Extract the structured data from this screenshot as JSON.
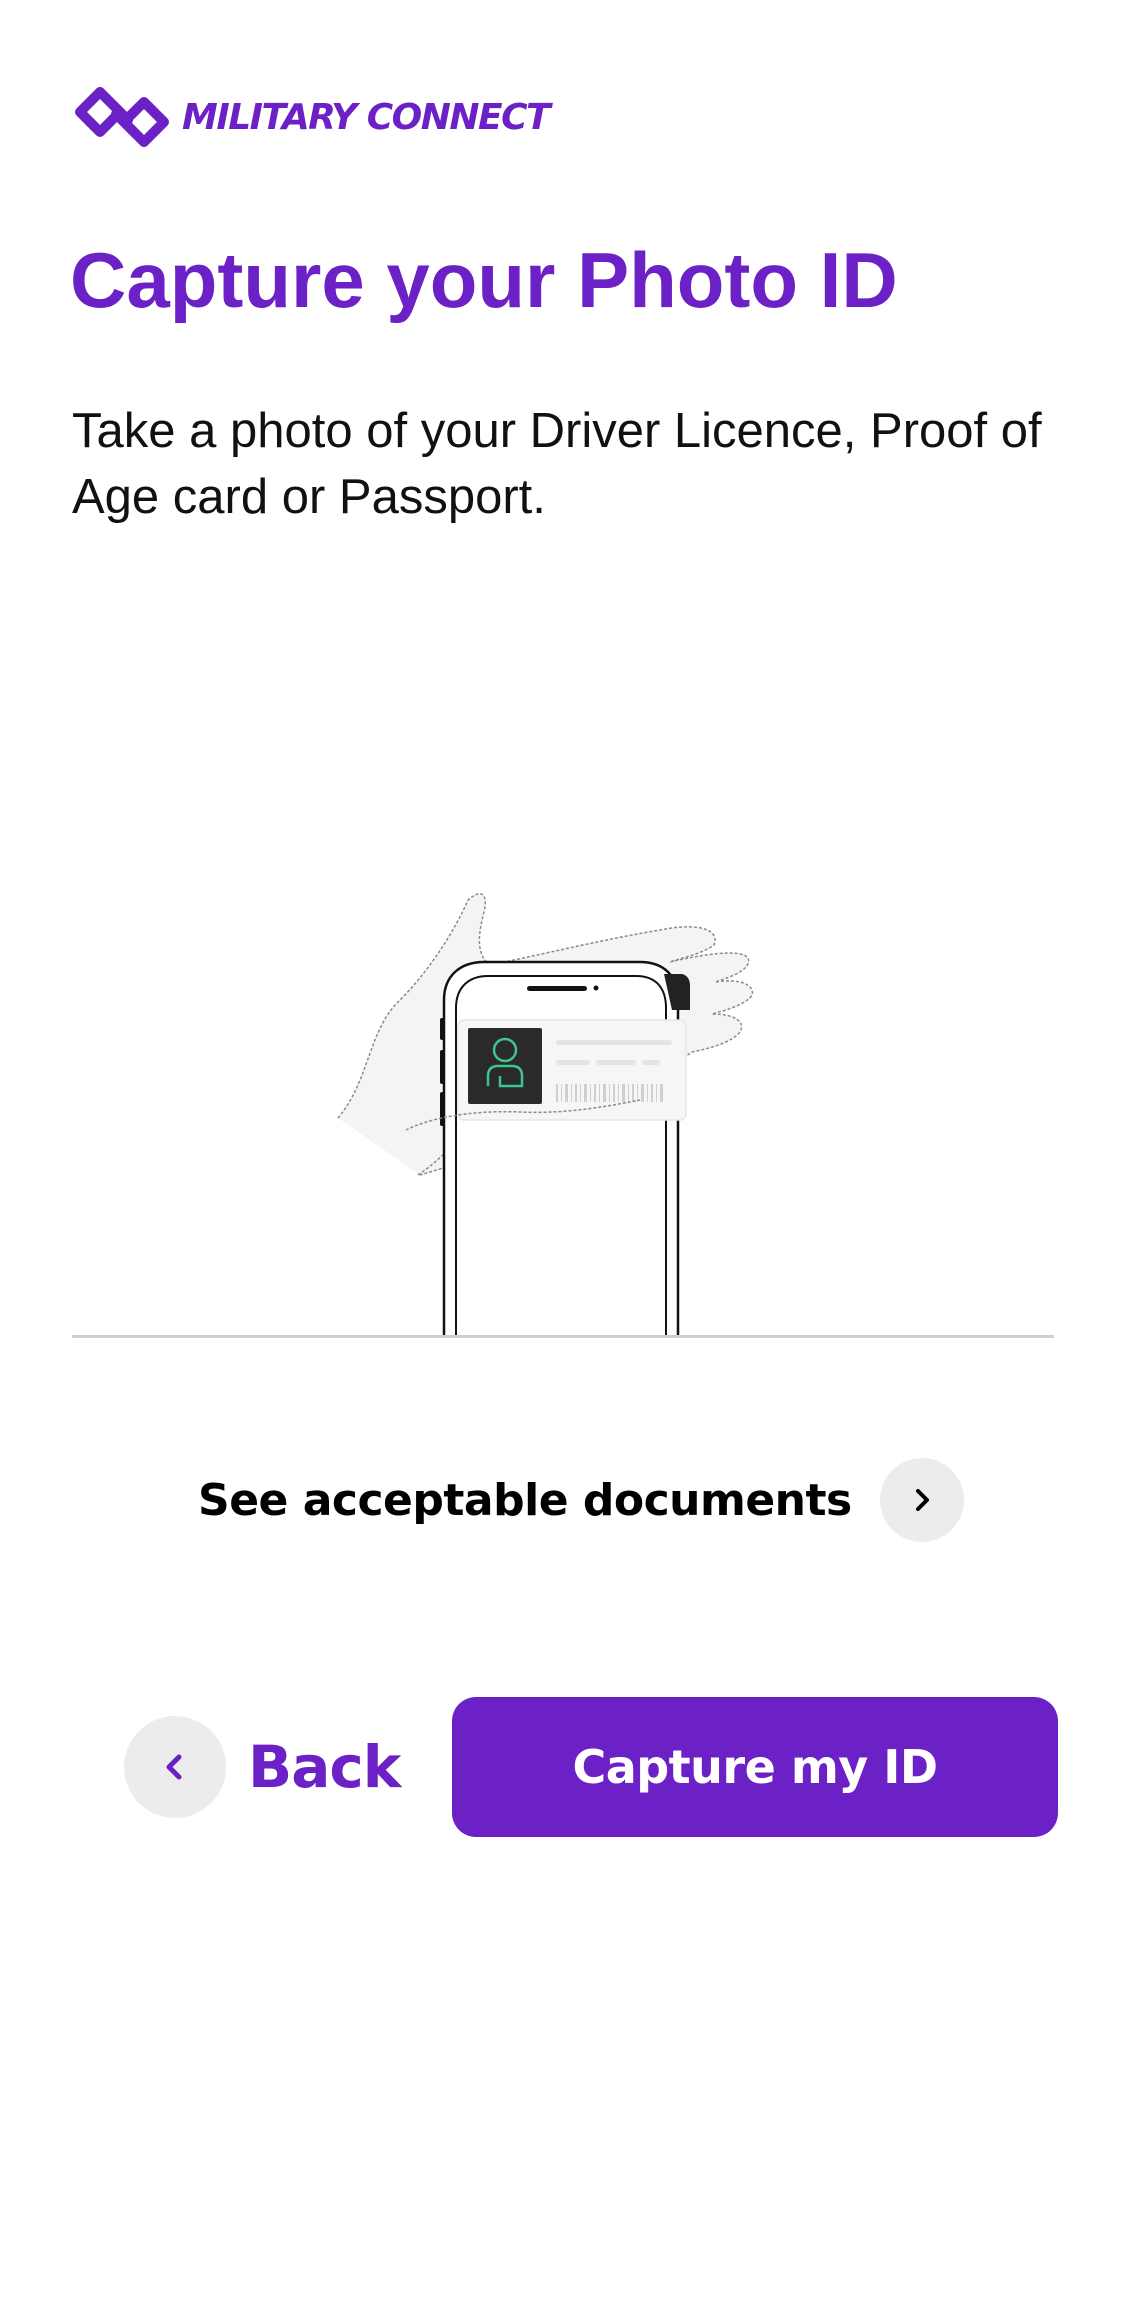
{
  "brand": {
    "name": "MILITARY CONNECT",
    "logo_icon": "linked-rings-logo-icon",
    "color": "#6b21c5"
  },
  "page": {
    "title": "Capture your Photo ID",
    "intro": "Take a photo of your Driver Licence, Proof of Age card or Passport."
  },
  "illustration": {
    "icon": "hand-holding-phone-with-id-card-illustration",
    "accent_color": "#3ec48f"
  },
  "links": {
    "acceptable_documents": "See acceptable documents",
    "acceptable_documents_icon": "chevron-right-icon"
  },
  "actions": {
    "back_label": "Back",
    "back_icon": "chevron-left-icon",
    "capture_label": "Capture my ID",
    "primary_color": "#6b21c5"
  }
}
